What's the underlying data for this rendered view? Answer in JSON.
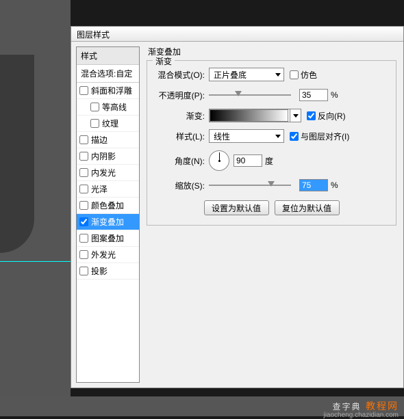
{
  "dialog_title": "图层样式",
  "sidebar": {
    "header": "样式",
    "blend_options": "混合选项:自定",
    "items": [
      {
        "label": "斜面和浮雕",
        "checked": false,
        "indent": false
      },
      {
        "label": "等高线",
        "checked": false,
        "indent": true
      },
      {
        "label": "纹理",
        "checked": false,
        "indent": true
      },
      {
        "label": "描边",
        "checked": false,
        "indent": false
      },
      {
        "label": "内阴影",
        "checked": false,
        "indent": false
      },
      {
        "label": "内发光",
        "checked": false,
        "indent": false
      },
      {
        "label": "光泽",
        "checked": false,
        "indent": false
      },
      {
        "label": "颜色叠加",
        "checked": false,
        "indent": false
      },
      {
        "label": "渐变叠加",
        "checked": true,
        "indent": false,
        "active": true
      },
      {
        "label": "图案叠加",
        "checked": false,
        "indent": false
      },
      {
        "label": "外发光",
        "checked": false,
        "indent": false
      },
      {
        "label": "投影",
        "checked": false,
        "indent": false
      }
    ]
  },
  "panel": {
    "title": "渐变叠加",
    "fieldset_title": "渐变",
    "blend_mode_label": "混合模式(O):",
    "blend_mode_value": "正片叠底",
    "dither_label": "仿色",
    "opacity_label": "不透明度(P):",
    "opacity_value": "35",
    "gradient_label": "渐变:",
    "reverse_label": "反向(R)",
    "style_label": "样式(L):",
    "style_value": "线性",
    "align_label": "与图层对齐(I)",
    "angle_label": "角度(N):",
    "angle_value": "90",
    "angle_unit": "度",
    "scale_label": "缩放(S):",
    "scale_value": "75",
    "percent": "%",
    "btn_default": "设置为默认值",
    "btn_reset": "复位为默认值"
  },
  "footer": {
    "main": "查字典",
    "orange": "教程网",
    "sub": "jiaocheng.chazidian.com"
  }
}
